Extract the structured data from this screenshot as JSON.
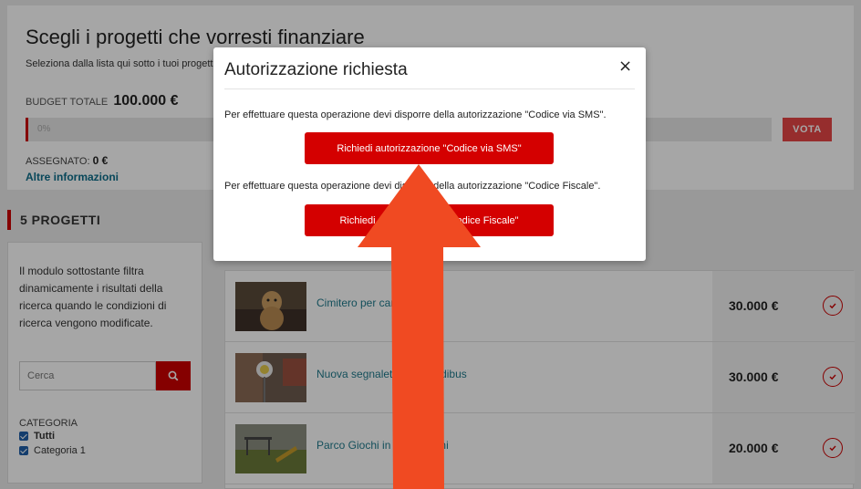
{
  "header": {
    "title": "Scegli i progetti che vorresti finanziare",
    "subtitle": "Seleziona dalla lista qui sotto i tuoi progetti preferiti",
    "budget_label": "BUDGET TOTALE",
    "budget_value": "100.000 €",
    "progress_text": "0%",
    "vote_label": "VOTA",
    "assigned_label": "ASSEGNATO:",
    "assigned_value": "0 €",
    "more_info": "Altre informazioni"
  },
  "projects_heading": "5 PROGETTI",
  "filters": {
    "description": "Il modulo sottostante filtra dinamicamente i risultati della ricerca quando le condizioni di ricerca vengono modificate.",
    "search_placeholder": "Cerca",
    "category_label": "CATEGORIA",
    "options": [
      "Tutti",
      "Categoria 1"
    ]
  },
  "projects": [
    {
      "title": "Cimitero per cani",
      "price": "30.000 €"
    },
    {
      "title": "Nuova segnaletica del Pedibus",
      "price": "30.000 €"
    },
    {
      "title": "Parco Giochi in via Speroni",
      "price": "20.000 €"
    }
  ],
  "modal": {
    "title": "Autorizzazione richiesta",
    "close": "×",
    "sms_text": "Per effettuare questa operazione devi disporre della autorizzazione \"Codice via SMS\".",
    "sms_button": "Richiedi autorizzazione \"Codice via SMS\"",
    "cf_text": "Per effettuare questa operazione devi disporre della autorizzazione \"Codice Fiscale\".",
    "cf_button": "Richiedi autorizzazione \"Codice Fiscale\""
  },
  "colors": {
    "accent": "#d40000",
    "link": "#1f7a8c",
    "annotation_arrow": "#f04a22"
  }
}
